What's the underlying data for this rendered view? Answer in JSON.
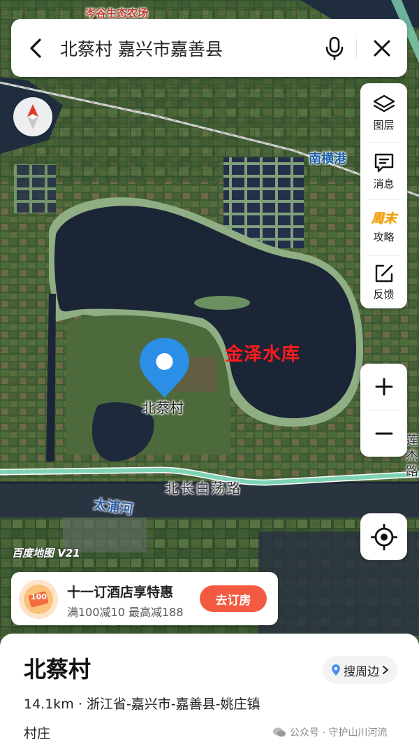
{
  "map": {
    "labels": {
      "farm": "岑谷生态农场",
      "nanhenggang": "南横港",
      "reservoir": "金泽水库",
      "village": "北蔡村",
      "road": "北长白荡路",
      "river": "太浦河",
      "right_road": "莲杰路",
      "brand": "百度地图 V21"
    },
    "colors": {
      "reservoir_label": "#ff1c1c",
      "pin": "#2b8fe8",
      "road": "#7fd3b5"
    }
  },
  "search": {
    "query": "北蔡村 嘉兴市嘉善县",
    "back_icon": "chevron-left-icon",
    "mic_icon": "microphone-icon",
    "close_icon": "close-icon"
  },
  "compass": {
    "icon": "compass-icon"
  },
  "tools": [
    {
      "label": "图层",
      "icon": "layers-icon"
    },
    {
      "label": "消息",
      "icon": "message-icon"
    },
    {
      "label": "攻略",
      "icon": "guide-icon",
      "badge": "周末"
    },
    {
      "label": "反馈",
      "icon": "feedback-icon"
    }
  ],
  "zoom": {
    "in": "+",
    "out": "−"
  },
  "locate": {
    "icon": "locate-icon"
  },
  "promo": {
    "title": "十一订酒店享特惠",
    "subtitle": "满100减10 最高减188",
    "button": "去订房",
    "icon_badge": "100",
    "button_color": "#f45a41"
  },
  "place": {
    "name": "北蔡村",
    "nearby_button": "搜周边",
    "address": "14.1km · 浙江省-嘉兴市-嘉善县-姚庄镇",
    "type": "村庄"
  },
  "footer": {
    "watermark": "公众号 · 守护山川河流"
  }
}
